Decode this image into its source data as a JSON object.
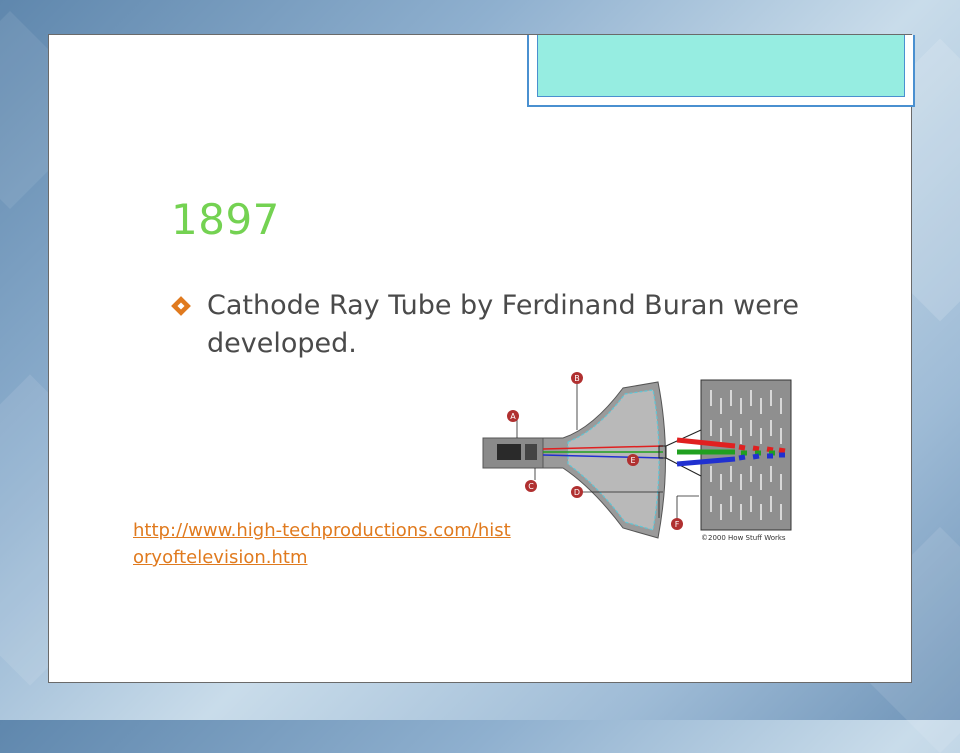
{
  "slide": {
    "title": "1897",
    "bullet": "Cathode Ray Tube by Ferdinand Buran were developed.",
    "link": "http://www.high-techproductions.com/historyoftelevision.htm"
  },
  "diagram": {
    "labels": [
      "A",
      "B",
      "C",
      "D",
      "E",
      "F"
    ],
    "credit": "©2000 How Stuff Works"
  },
  "colors": {
    "title": "#74d252",
    "bullet_text": "#4a4a4a",
    "link": "#e07a1e",
    "tab_fill": "#96ede1",
    "tab_border": "#4a90d0",
    "beam_red": "#e02020",
    "beam_green": "#20a020",
    "beam_blue": "#2030d0"
  },
  "icons": {
    "bullet": "diamond-bullet-icon"
  }
}
